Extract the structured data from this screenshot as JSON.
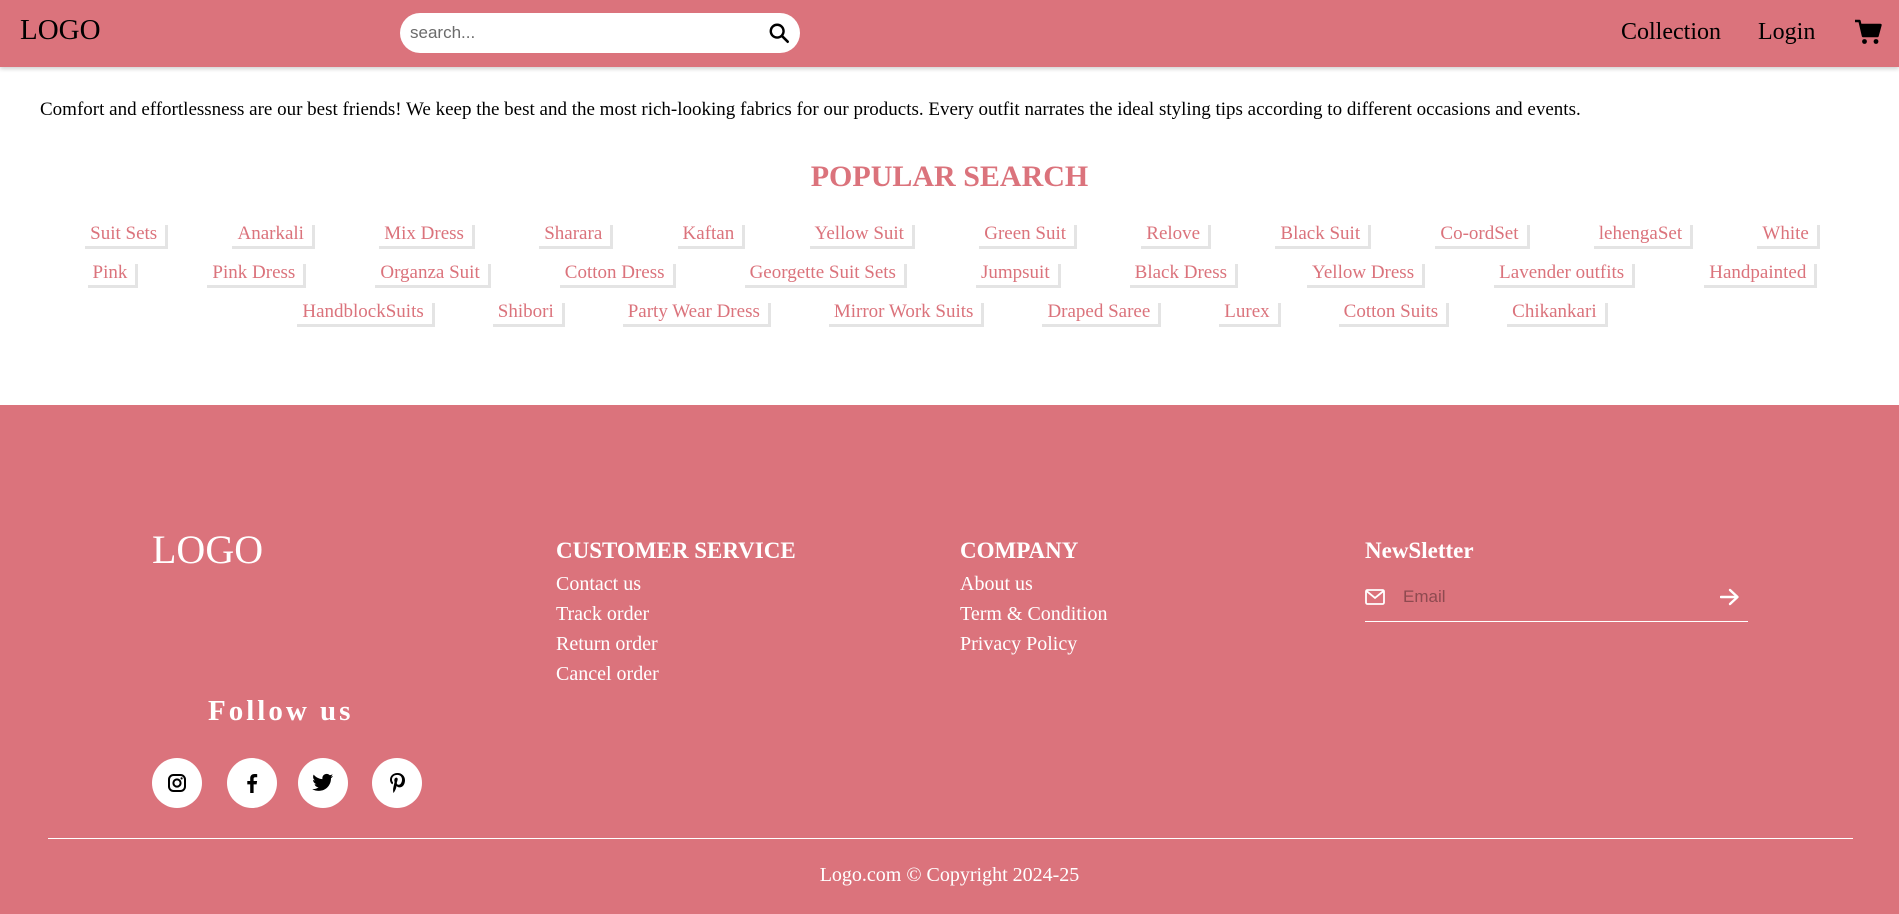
{
  "header": {
    "logo": "LOGO",
    "search_placeholder": "search...",
    "nav": [
      "Collection",
      "Login"
    ],
    "cart_icon": "cart-icon"
  },
  "intro": "Comfort and effortlessness are our best friends! We keep the best and the most rich-looking fabrics for our products. Every outfit narrates the ideal styling tips according to different occasions and events.",
  "popular": {
    "title": "POPULAR SEARCH",
    "rows": [
      [
        "Suit Sets",
        "Anarkali",
        "Mix Dress",
        "Sharara",
        "Kaftan",
        "Yellow Suit",
        "Green Suit",
        "Relove",
        "Black Suit",
        "Co-ordSet",
        "lehengaSet",
        "White"
      ],
      [
        "Pink",
        "Pink Dress",
        "Organza Suit",
        "Cotton Dress",
        "Georgette Suit Sets",
        "Jumpsuit",
        "Black Dress",
        "Yellow Dress",
        "Lavender outfits",
        "Handpainted"
      ],
      [
        "HandblockSuits",
        "Shibori",
        "Party Wear Dress",
        "Mirror Work Suits",
        "Draped Saree",
        "Lurex",
        "Cotton Suits",
        "Chikankari"
      ]
    ]
  },
  "footer": {
    "logo": "LOGO",
    "customer_service": {
      "title": "CUSTOMER SERVICE",
      "links": [
        "Contact us",
        "Track order",
        "Return order",
        "Cancel order"
      ]
    },
    "company": {
      "title": "COMPANY",
      "links": [
        "About us",
        "Term & Condition",
        "Privacy Policy"
      ]
    },
    "newsletter": {
      "title": "NewSletter",
      "email_placeholder": "Email"
    },
    "follow_title": "Follow us",
    "social_icons": [
      "instagram-icon",
      "facebook-icon",
      "twitter-icon",
      "pinterest-icon"
    ],
    "copyright": "Logo.com © Copyright 2024-25"
  },
  "colors": {
    "brand": "#db737c",
    "tag_shadow": "#e4e4e4"
  }
}
